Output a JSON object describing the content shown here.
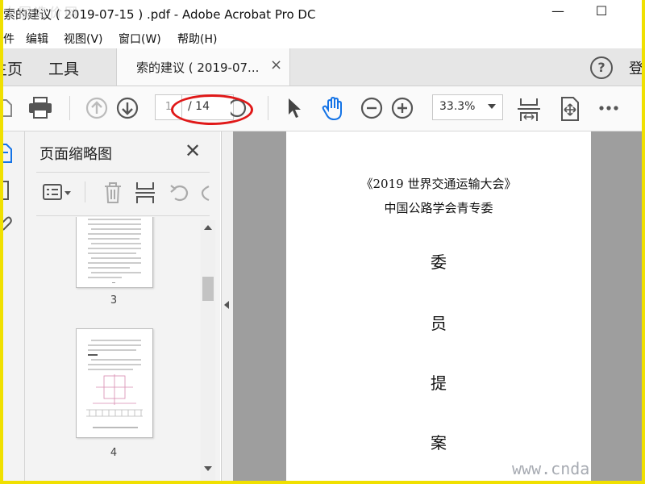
{
  "window": {
    "title": "索的建议 ( 2019-07-15 ) .pdf - Adobe Acrobat Pro DC",
    "minimize": "—",
    "maximize": "☐",
    "watermark_top": "中国造价网"
  },
  "menu": {
    "items": [
      {
        "label": "件"
      },
      {
        "label": "编辑"
      },
      {
        "label": "视图(V)"
      },
      {
        "label": "窗口(W)"
      },
      {
        "label": "帮助(H)"
      }
    ]
  },
  "tabs": {
    "home": "主页",
    "tools": "工具",
    "document": "索的建议 ( 2019-07...",
    "close": "×",
    "help": "?",
    "login": "登"
  },
  "toolbar": {
    "page_current": "1",
    "page_total": "/ 14",
    "zoom": "33.3%"
  },
  "panel": {
    "title": "页面缩略图",
    "close": "✕",
    "thumbs": [
      {
        "label": "3"
      },
      {
        "label": "4"
      }
    ]
  },
  "document": {
    "line1": "《2019 世界交通运输大会》",
    "line2": "中国公路学会青专委",
    "big": [
      "委",
      "员",
      "提",
      "案"
    ],
    "watermark": "www.cnda"
  },
  "colors": {
    "accent_blue": "#1473e6",
    "annotation_red": "#e01818",
    "frame_yellow": "#f0e000"
  }
}
